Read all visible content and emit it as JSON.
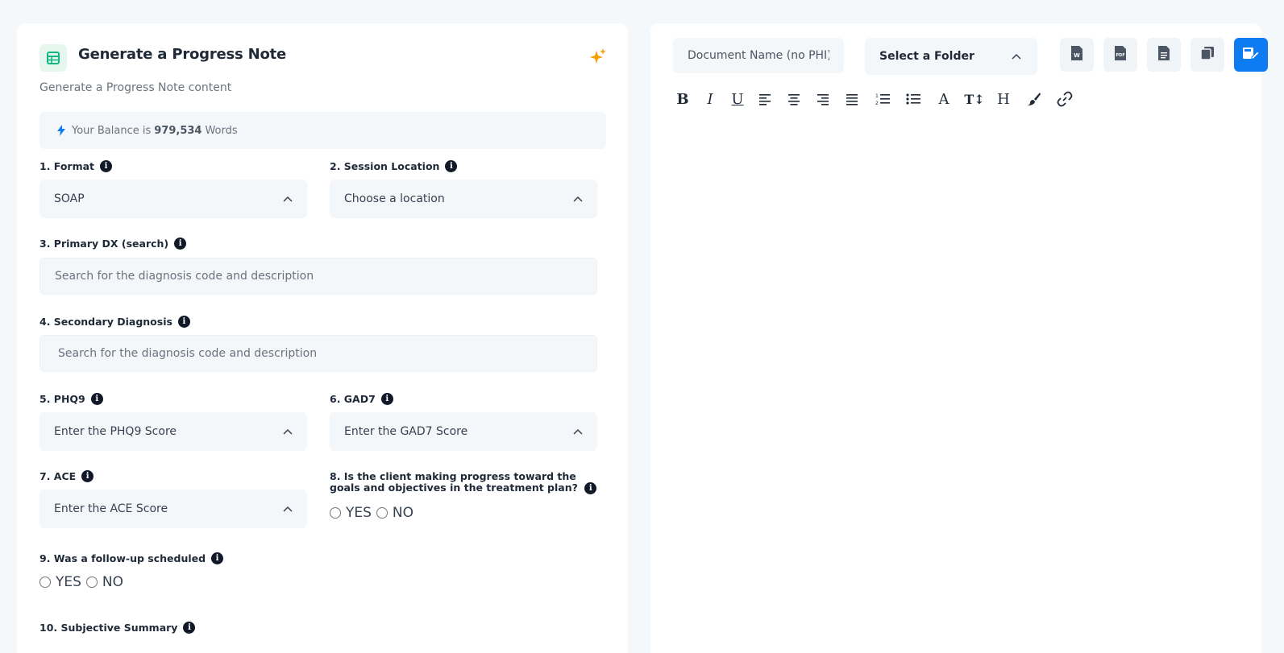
{
  "left_panel": {
    "title": "Generate a Progress Note",
    "subtitle": "Generate a Progress Note content",
    "balance": {
      "prefix": "Your Balance is",
      "amount": "979,534",
      "suffix": "Words"
    },
    "fields": {
      "format": {
        "label": "1. Format",
        "value": "SOAP"
      },
      "session_location": {
        "label": "2. Session Location",
        "value": "Choose a location"
      },
      "primary_dx": {
        "label": "3. Primary DX (search)",
        "placeholder": "Search for the diagnosis code and description"
      },
      "secondary_dx": {
        "label": "4. Secondary Diagnosis",
        "placeholder": "Search for the diagnosis code and description"
      },
      "phq9": {
        "label": "5. PHQ9",
        "value": "Enter the PHQ9 Score"
      },
      "gad7": {
        "label": "6. GAD7",
        "value": "Enter the GAD7 Score"
      },
      "ace": {
        "label": "7. ACE",
        "value": "Enter the ACE Score"
      },
      "progress": {
        "label": "8. Is the client making progress toward the goals and objectives in the treatment plan?",
        "yes": "YES",
        "no": "NO"
      },
      "follow_up": {
        "label": "9. Was a follow-up scheduled",
        "yes": "YES",
        "no": "NO"
      },
      "subjective": {
        "label": "10. Subjective Summary"
      }
    }
  },
  "right_panel": {
    "document_name_placeholder": "Document Name (no PHI)",
    "folder": "Select a Folder",
    "toolbar_icons": [
      "word-export-icon",
      "pdf-export-icon",
      "text-doc-icon",
      "copy-icon",
      "save-edit-icon"
    ],
    "format_buttons": [
      "bold",
      "italic",
      "underline",
      "align-left",
      "align-center",
      "align-right",
      "justify",
      "ordered-list",
      "bullet-list",
      "font",
      "text-size",
      "heading",
      "paint-brush",
      "link"
    ]
  },
  "colors": {
    "accent": "#0d7cf2",
    "brand_green": "#10b981",
    "sparkle": "#f59e0b"
  }
}
